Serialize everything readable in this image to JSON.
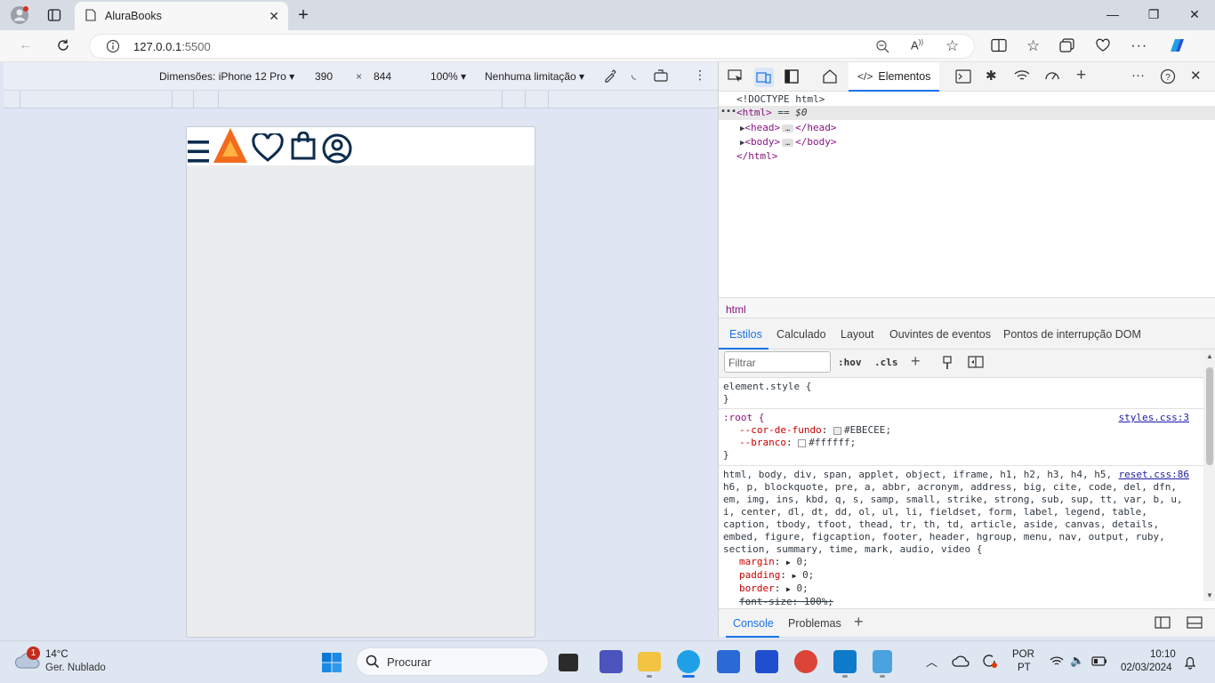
{
  "browser": {
    "tab_title": "AluraBooks",
    "url_host": "127.0.0.1",
    "url_port": ":5500"
  },
  "device_toolbar": {
    "device": "Dimensões: iPhone 12 Pro",
    "width": "390",
    "times": "×",
    "height": "844",
    "zoom": "100%",
    "throttling": "Nenhuma limitação"
  },
  "devtools": {
    "elements_tab": "Elementos",
    "dom": {
      "doctype": "<!DOCTYPE html>",
      "html_open": "<html>",
      "html_marker": "== $0",
      "head_open": "<head>",
      "head_close": "</head>",
      "body_open": "<body>",
      "body_close": "</body>",
      "html_close": "</html>"
    },
    "breadcrumb": "html",
    "style_tabs": [
      "Estilos",
      "Calculado",
      "Layout",
      "Ouvintes de eventos",
      "Pontos de interrupção DOM"
    ],
    "filter_placeholder": "Filtrar",
    "hov": ":hov",
    "cls": ".cls",
    "rules": {
      "element_style": "element.style {",
      "close": "}",
      "root_selector": ":root {",
      "root_source": "styles.css:3",
      "var1_name": "--cor-de-fundo",
      "var1_value": "#EBECEE;",
      "var1_color": "#EBECEE",
      "var2_name": "--branco",
      "var2_value": "#ffffff;",
      "var2_color": "#ffffff",
      "reset_selector_line1": "html, body, div, span, applet, object, iframe, h1, h2, h3, h4, h5,",
      "reset_source": "reset.css:86",
      "reset_selector_line2": "h6, p, blockquote, pre, a, abbr, acronym, address, big, cite, code, del, dfn,",
      "reset_selector_line3": "em, img, ins, kbd, q, s, samp, small, strike, strong, sub, sup, tt, var, b, u,",
      "reset_selector_line4": "i, center, dl, dt, dd, ol, ul, li, fieldset, form, label, legend, table,",
      "reset_selector_line5": "caption, tbody, tfoot, thead, tr, th, td, article, aside, canvas, details,",
      "reset_selector_line6": "embed, figure, figcaption, footer, header, hgroup, menu, nav, output, ruby,",
      "reset_selector_line7": "section, summary, time, mark, audio, video {",
      "margin": "margin",
      "padding": "padding",
      "border": "border",
      "font_size": "font-size: 100%;",
      "zero": "0;"
    },
    "drawer_tabs": [
      "Console",
      "Problemas"
    ]
  },
  "taskbar": {
    "weather_temp": "14°C",
    "weather_desc": "Ger. Nublado",
    "weather_badge": "1",
    "search_label": "Procurar",
    "lang1": "POR",
    "lang2": "PT",
    "time": "10:10",
    "date": "02/03/2024"
  },
  "colors": {
    "accent": "#1a73e8",
    "logo_orange": "#f26b1d",
    "icon_navy": "#0c2c4e"
  }
}
